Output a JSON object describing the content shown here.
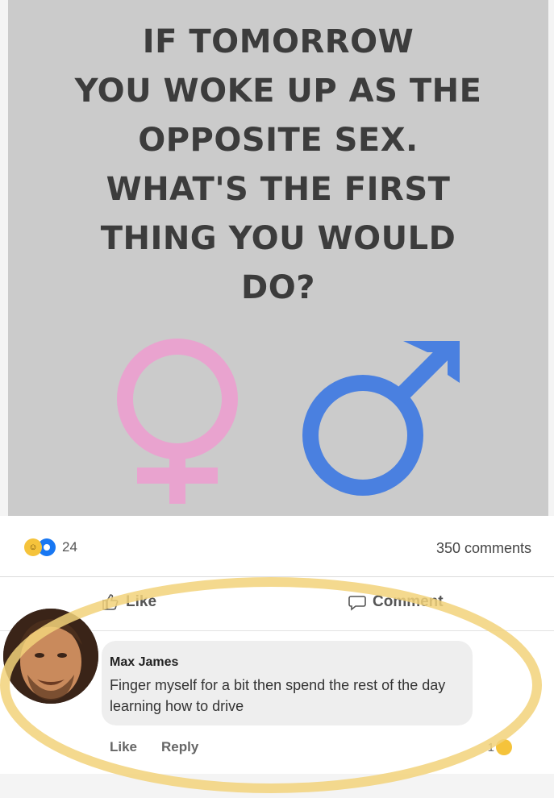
{
  "post": {
    "headline_lines": [
      "IF TOMORROW",
      "YOU WOKE UP AS THE",
      "OPPOSITE SEX.",
      "WHAT'S THE FIRST",
      "THING YOU WOULD",
      "DO?"
    ],
    "female_color": "#e9a3cf",
    "male_color": "#4a80e0",
    "background_color": "#cbcbcb"
  },
  "stats": {
    "reaction_count": "24",
    "comments_label": "350 comments",
    "reaction_icons": [
      "laugh-reaction-icon",
      "wow-reaction-icon"
    ]
  },
  "actions": {
    "like_label": "Like",
    "comment_label": "Comment"
  },
  "comment": {
    "author": "Max James",
    "text": "Finger myself for a bit then spend the rest of the day learning how to drive",
    "like_label": "Like",
    "reply_label": "Reply",
    "reaction_count": "1"
  },
  "highlight_color": "#f2d27a"
}
